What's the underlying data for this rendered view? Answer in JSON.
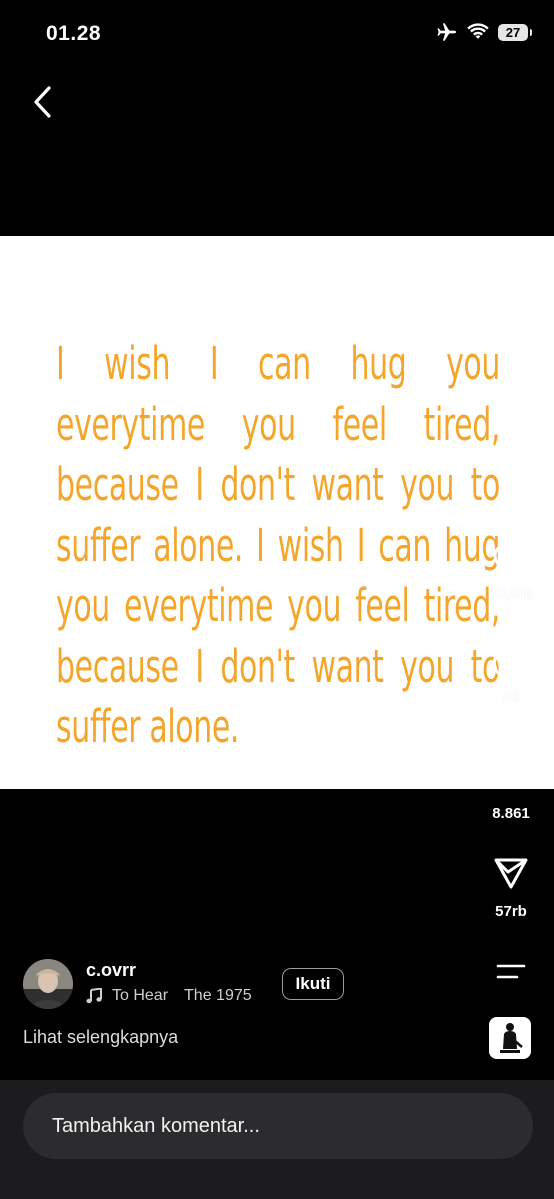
{
  "status_bar": {
    "time": "01.28",
    "battery": "27",
    "icons": [
      "airplane-icon",
      "wifi-icon",
      "battery-icon"
    ]
  },
  "nav": {
    "back_icon": "chevron-left-icon"
  },
  "post": {
    "image_text": "I wish I can hug you everytime you feel tired, because I don't want you to suffer alone. I wish I can hug you everytime you feel tired, because I don't want you to suffer alone.",
    "text_color": "#f3a62b"
  },
  "actions": {
    "like_count": "62,9rb",
    "comment_count": "49",
    "repost_count": "8.861",
    "share_count": "57rb"
  },
  "author": {
    "username": "c.ovrr",
    "music_title": "To Hear",
    "music_artist": "The 1975",
    "follow_label": "Ikuti"
  },
  "caption": {
    "see_more_label": "Lihat selengkapnya"
  },
  "comment": {
    "placeholder": "Tambahkan komentar..."
  }
}
